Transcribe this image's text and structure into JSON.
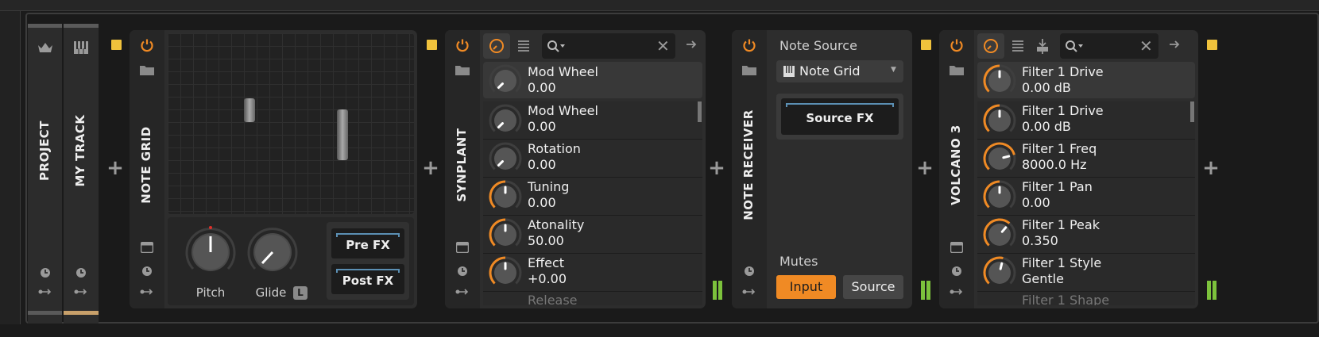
{
  "colors": {
    "accent": "#f08a24",
    "yellow": "#f0c23c",
    "meter": "#7cc23c",
    "background": "#1b1b1b",
    "panel": "#2d2d2d"
  },
  "project": {
    "label": "PROJECT",
    "icon": "crown-icon"
  },
  "track": {
    "label": "MY TRACK",
    "icon": "piano-keys-icon"
  },
  "note_grid": {
    "title": "NOTE GRID",
    "pitch_label": "Pitch",
    "glide_label": "Glide",
    "glide_badge": "L",
    "pre_fx": "Pre FX",
    "post_fx": "Post FX"
  },
  "synplant": {
    "title": "SYNPLANT",
    "params": [
      {
        "name": "Mod Wheel",
        "value": "0.00",
        "level": 0.0
      },
      {
        "name": "Mod Wheel",
        "value": "0.00",
        "level": 0.0
      },
      {
        "name": "Rotation",
        "value": "0.00",
        "level": 0.0
      },
      {
        "name": "Tuning",
        "value": "0.00",
        "level": 0.5
      },
      {
        "name": "Atonality",
        "value": "50.00",
        "level": 0.5
      },
      {
        "name": "Effect",
        "value": "+0.00",
        "level": 0.5
      },
      {
        "name": "Release",
        "value": ""
      }
    ]
  },
  "note_receiver": {
    "title": "NOTE RECEIVER",
    "source_label": "Note Source",
    "source_value": "Note Grid",
    "source_fx": "Source FX",
    "mutes_label": "Mutes",
    "input_btn": "Input",
    "source_btn": "Source"
  },
  "volcano": {
    "title": "VOLCANO 3",
    "params": [
      {
        "name": "Filter 1 Drive",
        "value": "0.00 dB",
        "level": 0.5
      },
      {
        "name": "Filter 1 Drive",
        "value": "0.00 dB",
        "level": 0.5
      },
      {
        "name": "Filter 1 Freq",
        "value": "8000.0 Hz",
        "level": 0.78
      },
      {
        "name": "Filter 1 Pan",
        "value": "0.00",
        "level": 0.5
      },
      {
        "name": "Filter 1 Peak",
        "value": "0.350",
        "level": 0.65
      },
      {
        "name": "Filter 1 Style",
        "value": "Gentle",
        "level": 0.55
      },
      {
        "name": "Filter 1 Shape",
        "value": ""
      }
    ]
  }
}
